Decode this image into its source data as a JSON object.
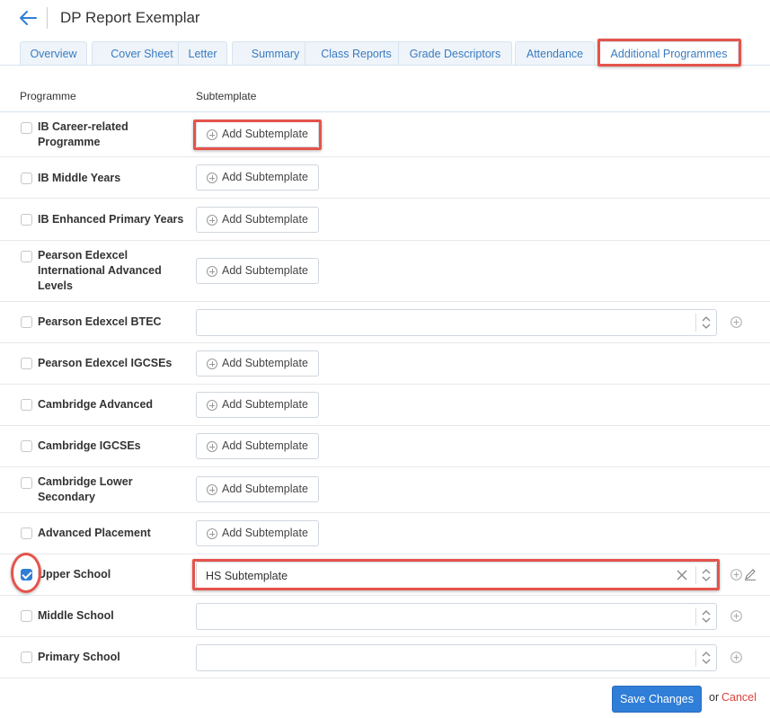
{
  "header": {
    "title": "DP Report Exemplar",
    "back_icon": "arrow-left-icon"
  },
  "tabs": [
    {
      "label": "Overview"
    },
    {
      "label": "Cover Sheet"
    },
    {
      "label": "Letter"
    },
    {
      "label": "Summary"
    },
    {
      "label": "Class Reports"
    },
    {
      "label": "Grade Descriptors"
    },
    {
      "label": "Attendance"
    },
    {
      "label": "Additional Programmes",
      "active": true
    }
  ],
  "table": {
    "col_programme": "Programme",
    "col_subtemplate": "Subtemplate",
    "add_label": "Add Subtemplate",
    "rows": [
      {
        "label": "IB Career-related Programme",
        "checked": false,
        "control": "button"
      },
      {
        "label": "IB Middle Years",
        "checked": false,
        "control": "button"
      },
      {
        "label": "IB Enhanced Primary Years",
        "checked": false,
        "control": "button"
      },
      {
        "label": "Pearson Edexcel International Advanced Levels",
        "checked": false,
        "control": "button"
      },
      {
        "label": "Pearson Edexcel BTEC",
        "checked": false,
        "control": "select",
        "value": ""
      },
      {
        "label": "Pearson Edexcel IGCSEs",
        "checked": false,
        "control": "button"
      },
      {
        "label": "Cambridge Advanced",
        "checked": false,
        "control": "button"
      },
      {
        "label": "Cambridge IGCSEs",
        "checked": false,
        "control": "button"
      },
      {
        "label": "Cambridge Lower Secondary",
        "checked": false,
        "control": "button"
      },
      {
        "label": "Advanced Placement",
        "checked": false,
        "control": "button"
      },
      {
        "label": "Upper School",
        "checked": true,
        "control": "select",
        "value": "HS Subtemplate"
      },
      {
        "label": "Middle School",
        "checked": false,
        "control": "select",
        "value": ""
      },
      {
        "label": "Primary School",
        "checked": false,
        "control": "select",
        "value": ""
      }
    ]
  },
  "footer": {
    "save_label": "Save Changes",
    "or_label": "or",
    "cancel_label": "Cancel"
  },
  "colors": {
    "accent": "#2f7ed8",
    "tab_text": "#3a7bbf",
    "highlight": "#e5534b",
    "cancel": "#e0413a"
  }
}
